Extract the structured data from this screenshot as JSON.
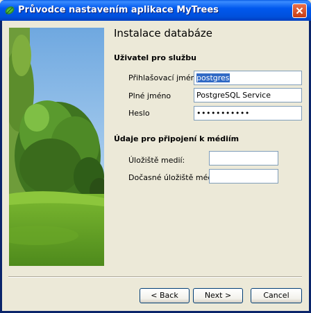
{
  "window": {
    "title": "Průvodce nastavením aplikace MyTrees"
  },
  "page": {
    "heading": "Instalace databáze"
  },
  "service_user": {
    "section_title": "Uživatel pro službu",
    "login_label": "Přihlašovací jméno",
    "login_value": "postgres",
    "fullname_label": "Plné jméno",
    "fullname_value": "PostgreSQL Service",
    "password_label": "Heslo",
    "password_value": "•••••••••••"
  },
  "media": {
    "section_title": "Údaje pro připojení k médiím",
    "storage_label": "Úložiště medií:",
    "storage_value": "",
    "temp_storage_label": "Dočasné úložiště médií:",
    "temp_storage_value": ""
  },
  "buttons": {
    "back": "< Back",
    "next": "Next >",
    "cancel": "Cancel"
  },
  "colors": {
    "titlebar": "#0054e3",
    "dialog_bg": "#ece9d8",
    "selection": "#316ac5",
    "close_button": "#d8532a"
  }
}
